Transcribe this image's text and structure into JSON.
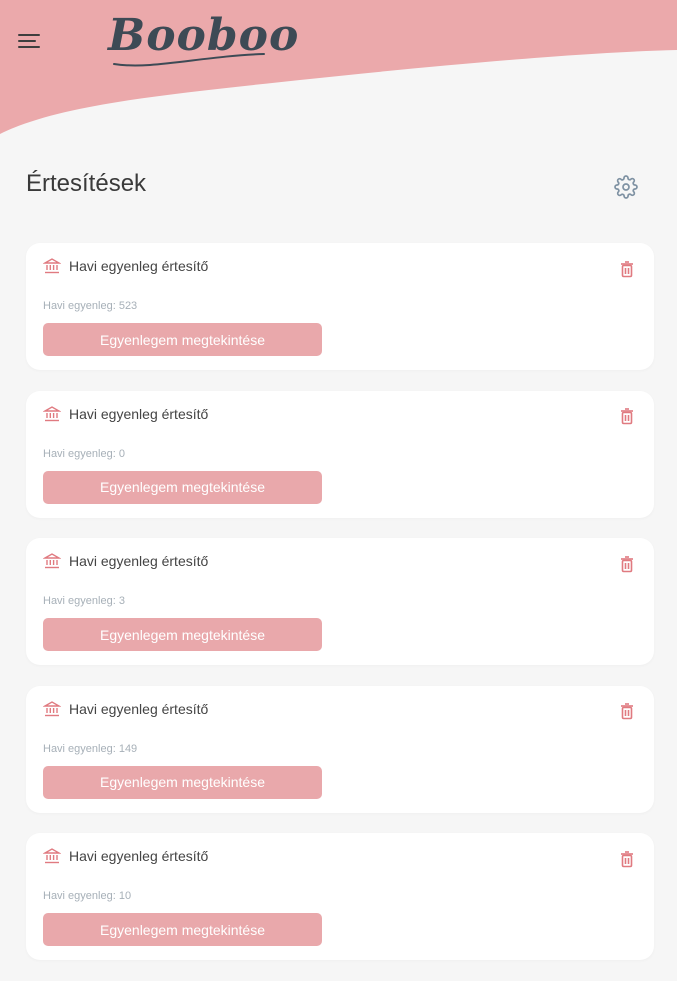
{
  "header": {
    "menu_icon": "hamburger-menu-icon",
    "logo_text": "Booboo",
    "accent_color": "#eba9ab"
  },
  "page": {
    "title": "Értesítések",
    "settings_icon": "gear-icon"
  },
  "notifications": [
    {
      "title": "Havi egyenleg értesítő",
      "balance_text": "Havi egyenleg: 523",
      "button_label": "Egyenlegem megtekintése",
      "icon": "bank-icon",
      "delete_icon": "trash-icon"
    },
    {
      "title": "Havi egyenleg értesítő",
      "balance_text": "Havi egyenleg: 0",
      "button_label": "Egyenlegem megtekintése",
      "icon": "bank-icon",
      "delete_icon": "trash-icon"
    },
    {
      "title": "Havi egyenleg értesítő",
      "balance_text": "Havi egyenleg: 3",
      "button_label": "Egyenlegem megtekintése",
      "icon": "bank-icon",
      "delete_icon": "trash-icon"
    },
    {
      "title": "Havi egyenleg értesítő",
      "balance_text": "Havi egyenleg: 149",
      "button_label": "Egyenlegem megtekintése",
      "icon": "bank-icon",
      "delete_icon": "trash-icon"
    },
    {
      "title": "Havi egyenleg értesítő",
      "balance_text": "Havi egyenleg: 10",
      "button_label": "Egyenlegem megtekintése",
      "icon": "bank-icon",
      "delete_icon": "trash-icon"
    }
  ]
}
